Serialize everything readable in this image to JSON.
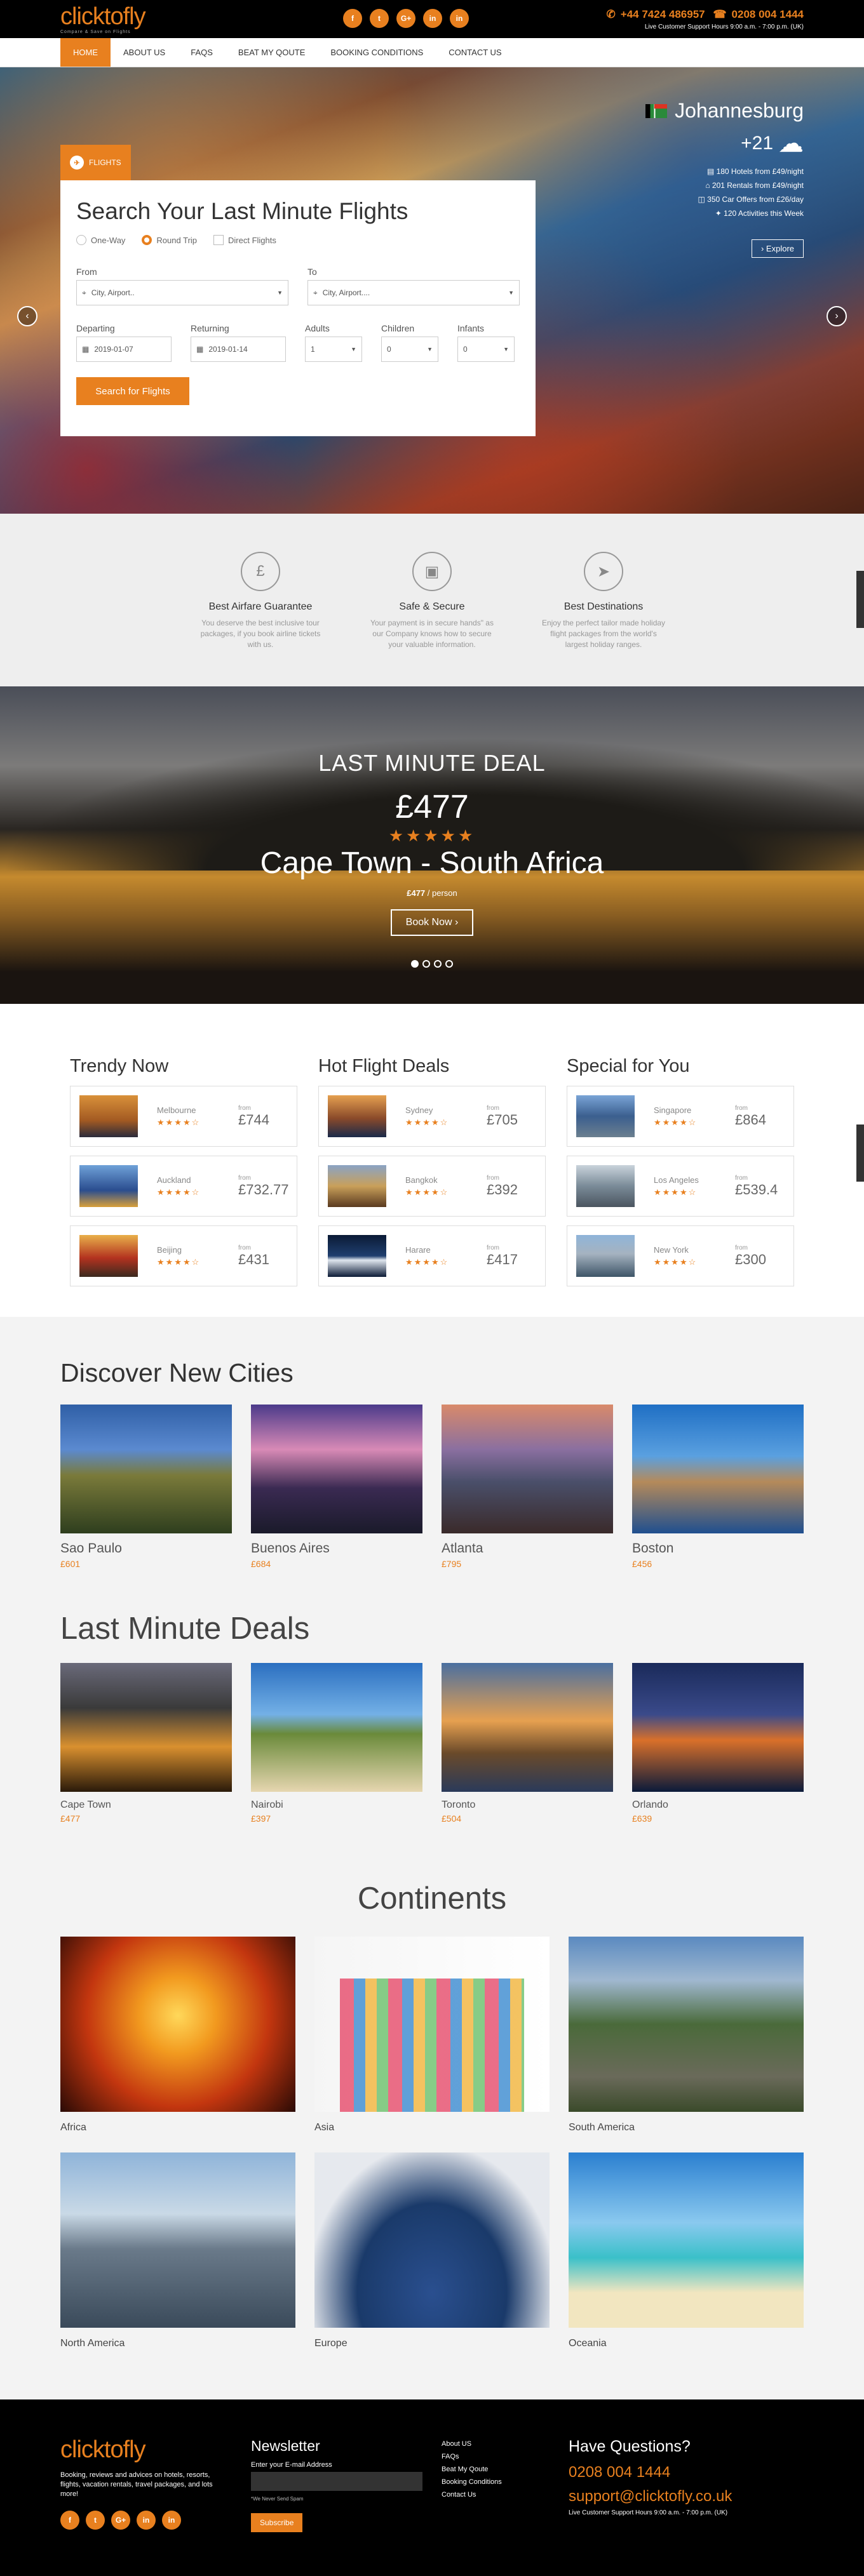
{
  "header": {
    "logo": "clicktofly",
    "logo_tagline": "Compare & Save on Flights",
    "phone1": "+44 7424 486957",
    "phone2": "0208 004 1444",
    "support_hours": "Live Customer Support Hours 9:00 a.m. - 7:00 p.m. (UK)",
    "socials": [
      "f",
      "t",
      "G+",
      "in",
      "in"
    ]
  },
  "nav": [
    "HOME",
    "ABOUT US",
    "FAQS",
    "BEAT MY QOUTE",
    "BOOKING CONDITIONS",
    "CONTACT US"
  ],
  "search": {
    "tab_label": "FLIGHTS",
    "title": "Search Your Last Minute Flights",
    "trip_types": [
      "One-Way",
      "Round Trip"
    ],
    "direct_label": "Direct Flights",
    "from_label": "From",
    "from_placeholder": "City, Airport..",
    "to_label": "To",
    "to_placeholder": "City, Airport....",
    "departing_label": "Departing",
    "departing_value": "2019-01-07",
    "returning_label": "Returning",
    "returning_value": "2019-01-14",
    "adults_label": "Adults",
    "adults_value": "1",
    "children_label": "Children",
    "children_value": "0",
    "infants_label": "Infants",
    "infants_value": "0",
    "button": "Search for Flights"
  },
  "weather": {
    "city": "Johannesburg",
    "temp": "+21",
    "stats": [
      "180 Hotels from £49/night",
      "201 Rentals from £49/night",
      "350 Car Offers from £26/day",
      "120 Activities this Week"
    ],
    "explore": "Explore"
  },
  "features": [
    {
      "title": "Best Airfare Guarantee",
      "text": "You deserve the best inclusive tour packages, if you book airline tickets with us.",
      "icon": "£"
    },
    {
      "title": "Safe & Secure",
      "text": "Your payment is in secure hands\" as our Company knows how to secure your valuable information.",
      "icon": "▣"
    },
    {
      "title": "Best Destinations",
      "text": "Enjoy the perfect tailor made holiday flight packages from the world's largest holiday ranges.",
      "icon": "➤"
    }
  ],
  "deal": {
    "heading": "LAST MINUTE DEAL",
    "price": "£477",
    "stars": "★★★★★",
    "destination": "Cape Town - South Africa",
    "per_price": "£477",
    "per_text": " / person",
    "button": "Book Now  ›"
  },
  "trends": [
    {
      "title": "Trendy Now",
      "items": [
        {
          "name": "Melbourne",
          "price": "£744",
          "stars": "★★★★☆"
        },
        {
          "name": "Auckland",
          "price": "£732.77",
          "stars": "★★★★☆"
        },
        {
          "name": "Beijing",
          "price": "£431",
          "stars": "★★★★☆"
        }
      ]
    },
    {
      "title": "Hot Flight Deals",
      "items": [
        {
          "name": "Sydney",
          "price": "£705",
          "stars": "★★★★☆"
        },
        {
          "name": "Bangkok",
          "price": "£392",
          "stars": "★★★★☆"
        },
        {
          "name": "Harare",
          "price": "£417",
          "stars": "★★★★☆"
        }
      ]
    },
    {
      "title": "Special for You",
      "items": [
        {
          "name": "Singapore",
          "price": "£864",
          "stars": "★★★★☆"
        },
        {
          "name": "Los Angeles",
          "price": "£539.4",
          "stars": "★★★★☆"
        },
        {
          "name": "New York",
          "price": "£300",
          "stars": "★★★★☆"
        }
      ]
    }
  ],
  "from_label": "from",
  "discover": {
    "title": "Discover New Cities",
    "items": [
      {
        "name": "Sao Paulo",
        "price": "£601"
      },
      {
        "name": "Buenos Aires",
        "price": "£684"
      },
      {
        "name": "Atlanta",
        "price": "£795"
      },
      {
        "name": "Boston",
        "price": "£456"
      }
    ]
  },
  "last_minute": {
    "title": "Last Minute Deals",
    "items": [
      {
        "name": "Cape Town",
        "price": "£477"
      },
      {
        "name": "Nairobi",
        "price": "£397"
      },
      {
        "name": "Toronto",
        "price": "£504"
      },
      {
        "name": "Orlando",
        "price": "£639"
      }
    ]
  },
  "continents": {
    "title": "Continents",
    "items": [
      "Africa",
      "Asia",
      "South America",
      "North America",
      "Europe",
      "Oceania"
    ]
  },
  "footer": {
    "logo": "clicktofly",
    "about": "Booking, reviews and advices on hotels, resorts, flights, vacation rentals, travel packages, and lots more!",
    "newsletter_title": "Newsletter",
    "email_label": "Enter your E-mail Address",
    "never_spam": "*We Never Send Spam",
    "subscribe": "Subscribe",
    "links": [
      "About US",
      "FAQs",
      "Beat My Qoute",
      "Booking Conditions",
      "Contact Us"
    ],
    "questions_title": "Have Questions?",
    "phone": "0208 004 1444",
    "email": "support@clicktofly.co.uk",
    "hours": "Live Customer Support Hours 9:00 a.m. - 7:00 p.m. (UK)"
  }
}
